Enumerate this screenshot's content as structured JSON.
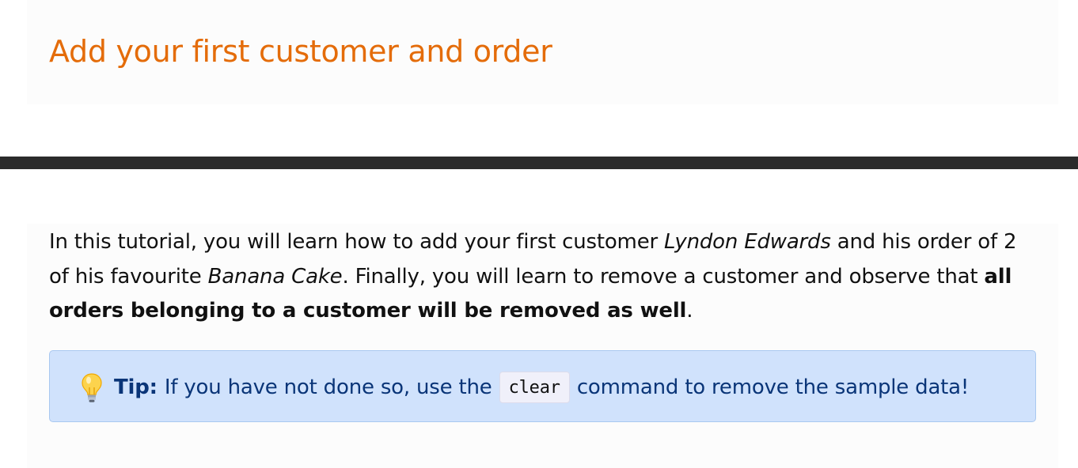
{
  "header": {
    "title": "Add your first customer and order"
  },
  "intro": {
    "part1": "In this tutorial, you will learn how to add your first customer ",
    "customer_name": "Lyndon Edwards",
    "part2": " and his order of 2 of his favourite ",
    "item_name": "Banana Cake",
    "part3": ". Finally, you will learn to remove a customer and observe that ",
    "emphasis": "all orders belonging to a customer will be removed as well",
    "part4": "."
  },
  "tip": {
    "icon": "lightbulb-icon",
    "label": "Tip:",
    "text_before": "If you have not done so, use the",
    "command": "clear",
    "text_after": "command to remove the sample data!"
  },
  "colors": {
    "title": "#e46c0a",
    "tip_background": "#d0e2fc",
    "tip_border": "#a9c8f0",
    "tip_text": "#0a3578",
    "divider": "#2b2b2b"
  }
}
